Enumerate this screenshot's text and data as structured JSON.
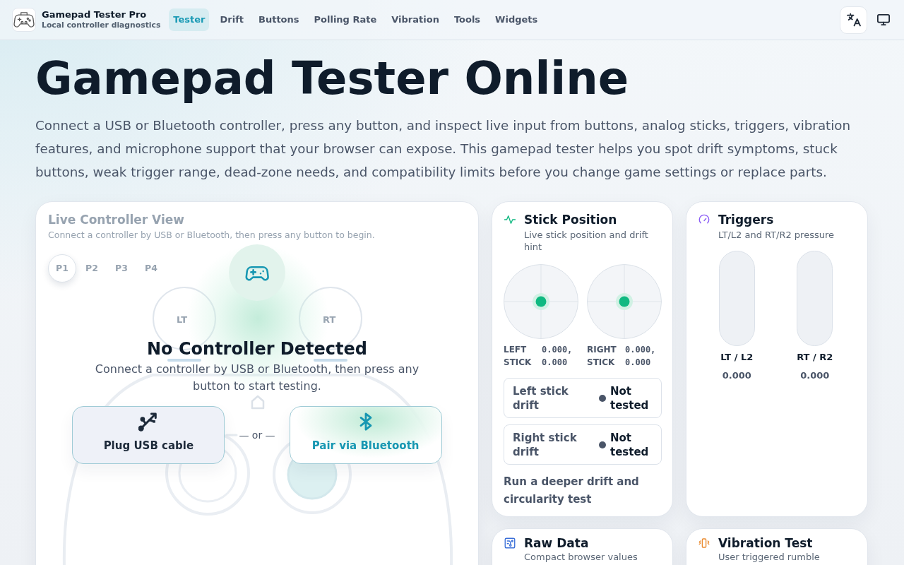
{
  "header": {
    "brand": {
      "title": "Gamepad Tester Pro",
      "subtitle": "Local controller diagnostics"
    },
    "nav": [
      {
        "label": "Tester",
        "selected": true
      },
      {
        "label": "Drift",
        "selected": false
      },
      {
        "label": "Buttons",
        "selected": false
      },
      {
        "label": "Polling Rate",
        "selected": false
      },
      {
        "label": "Vibration",
        "selected": false
      },
      {
        "label": "Tools",
        "selected": false
      },
      {
        "label": "Widgets",
        "selected": false
      }
    ]
  },
  "hero": {
    "title": "Gamepad Tester Online",
    "description": "Connect a USB or Bluetooth controller, press any button, and inspect live input from buttons, analog sticks, triggers, vibration features, and microphone support that your browser can expose. This gamepad tester helps you spot drift symptoms, stuck buttons, weak trigger range, dead-zone needs, and compatibility limits before you change game settings or replace parts."
  },
  "live_view": {
    "title": "Live Controller View",
    "subtitle": "Connect a controller by USB or Bluetooth, then press any button to begin.",
    "players": [
      {
        "label": "P1",
        "selected": true
      },
      {
        "label": "P2",
        "selected": false
      },
      {
        "label": "P3",
        "selected": false
      },
      {
        "label": "P4",
        "selected": false
      }
    ],
    "trigger_labels": [
      "LT",
      "RT"
    ],
    "overlay": {
      "title": "No Controller Detected",
      "description": "Connect a controller by USB or Bluetooth, then press any button to start testing.",
      "connect_options": [
        {
          "kind": "usb",
          "label": "Plug USB cable"
        },
        {
          "kind": "bluetooth",
          "label": "Pair via Bluetooth"
        }
      ],
      "separator": "— or —"
    }
  },
  "stick_position": {
    "title": "Stick Position",
    "subtitle": "Live stick position and drift hint",
    "sticks": [
      {
        "label": "LEFT STICK",
        "value": "0.000, 0.000"
      },
      {
        "label": "RIGHT STICK",
        "value": "0.000, 0.000"
      }
    ],
    "drift": [
      {
        "label": "Left stick drift",
        "status": "Not tested"
      },
      {
        "label": "Right stick drift",
        "status": "Not tested"
      }
    ],
    "link": "Run a deeper drift and circularity test"
  },
  "triggers": {
    "title": "Triggers",
    "subtitle": "LT/L2 and RT/R2 pressure",
    "items": [
      {
        "label": "LT / L2",
        "value": "0.000"
      },
      {
        "label": "RT / R2",
        "value": "0.000"
      }
    ]
  },
  "raw_data": {
    "title": "Raw Data",
    "subtitle": "Compact browser values"
  },
  "vibration_test": {
    "title": "Vibration Test",
    "subtitle": "User triggered rumble"
  }
}
